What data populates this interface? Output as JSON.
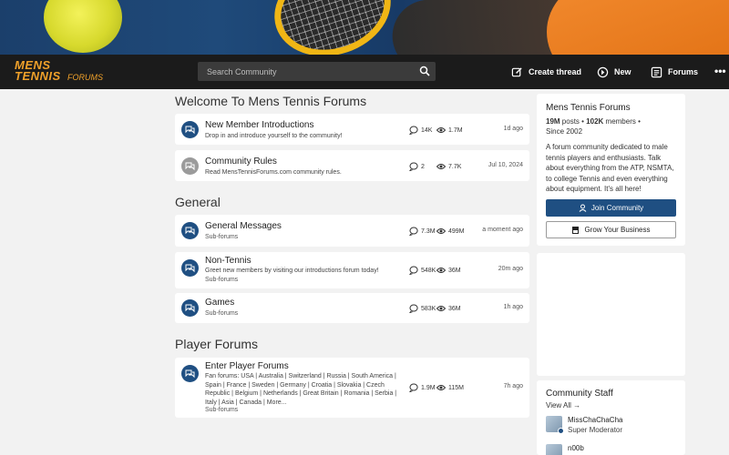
{
  "header": {
    "logo_line1": "MENS",
    "logo_line2": "TENNIS",
    "logo_suffix": "FORUMS",
    "search_placeholder": "Search Community",
    "nav": [
      {
        "label": "Create thread",
        "icon": "create-thread-icon"
      },
      {
        "label": "New",
        "icon": "new-icon"
      },
      {
        "label": "Forums",
        "icon": "forums-icon"
      }
    ],
    "more_label": "•••"
  },
  "sections": [
    {
      "title": "Welcome To Mens Tennis Forums",
      "forums": [
        {
          "title": "New Member Introductions",
          "desc": "Drop in and introduce yourself to the community!",
          "threads": "14K",
          "views": "1.7M",
          "ago": "1d ago",
          "icon_color": "blue"
        },
        {
          "title": "Community Rules",
          "desc": "Read MensTennisForums.com community rules.",
          "threads": "2",
          "views": "7.7K",
          "ago": "Jul 10, 2024",
          "icon_color": "grey"
        }
      ]
    },
    {
      "title": "General",
      "forums": [
        {
          "title": "General Messages",
          "sub": "Sub-forums",
          "threads": "7.3M",
          "views": "499M",
          "ago": "a moment ago"
        },
        {
          "title": "Non-Tennis",
          "desc": "Greet new members by visiting our introductions forum today!",
          "sub": "Sub-forums",
          "threads": "548K",
          "views": "36M",
          "ago": "20m ago"
        },
        {
          "title": "Games",
          "sub": "Sub-forums",
          "threads": "583K",
          "views": "36M",
          "ago": "1h ago"
        }
      ]
    },
    {
      "title": "Player Forums",
      "forums": [
        {
          "title": "Enter Player Forums",
          "desc": "Fan forums: USA | Australia | Switzerland | Russia | South America | Spain | France | Sweden | Germany | Croatia | Slovakia | Czech Republic | Belgium | Netherlands | Great Britain | Romania | Serbia | Italy | Asia | Canada | More...",
          "sub": "Sub-forums",
          "threads": "1.9M",
          "views": "115M",
          "ago": "7h ago"
        }
      ]
    }
  ],
  "sidebar": {
    "title": "Mens Tennis Forums",
    "posts_value": "19M",
    "posts_label": "posts",
    "members_value": "102K",
    "members_label": "members",
    "since": "Since 2002",
    "description": "A forum community dedicated to male tennis players and enthusiasts. Talk about everything from the ATP, NSMTA, to college Tennis and even everything about equipment. It's all here!",
    "join_label": "Join Community",
    "grow_label": "Grow Your Business",
    "staff_title": "Community Staff",
    "view_all": "View All →",
    "staff": [
      {
        "name": "MissChaChaCha",
        "role": "Super Moderator"
      },
      {
        "name": "n00b",
        "role": ""
      }
    ]
  },
  "colors": {
    "accent": "#1f4f82",
    "nav_bg": "#1b1b1b",
    "logo": "#f0a12a",
    "page_bg": "#f2f2f2"
  }
}
